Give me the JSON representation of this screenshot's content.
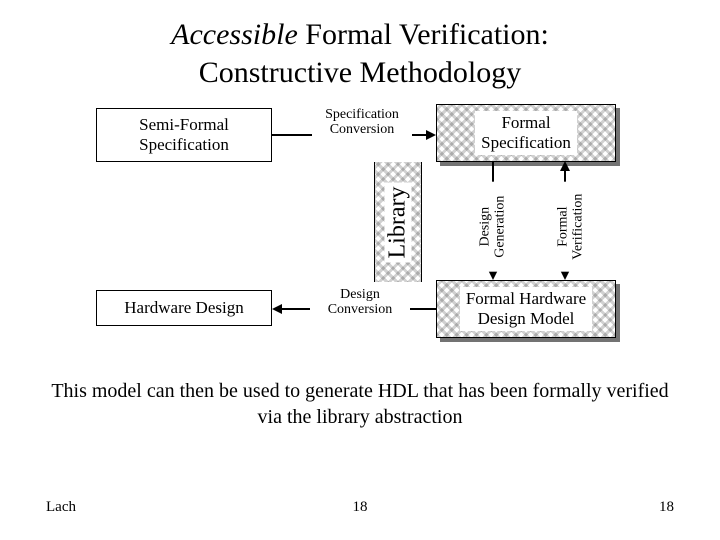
{
  "title": {
    "accessible": "Accessible",
    "rest_line1": " Formal Verification:",
    "line2": "Constructive Methodology"
  },
  "boxes": {
    "semi_formal_spec": "Semi-Formal\nSpecification",
    "hardware_design": "Hardware Design",
    "formal_spec": "Formal\nSpecification",
    "formal_model": "Formal Hardware\nDesign Model"
  },
  "labels": {
    "spec_conversion": "Specification\nConversion",
    "design_conversion": "Design\nConversion",
    "library": "Library",
    "design_generation": "Design\nGeneration",
    "formal_verification": "Formal\nVerification"
  },
  "caption": "This model can then be used to generate HDL that has been formally verified via the library abstraction",
  "footer": {
    "left": "Lach",
    "center": "18",
    "right": "18"
  }
}
